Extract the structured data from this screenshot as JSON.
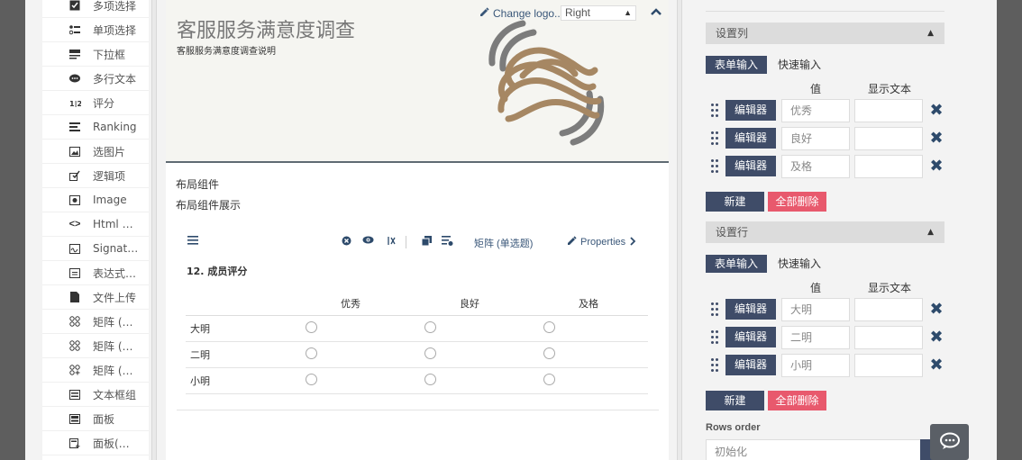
{
  "toolbox": {
    "items": [
      {
        "label": "多项选择",
        "icon": "checkbox-icon"
      },
      {
        "label": "单项选择",
        "icon": "radiogroup-icon"
      },
      {
        "label": "下拉框",
        "icon": "dropdown-icon"
      },
      {
        "label": "多行文本",
        "icon": "comment-icon"
      },
      {
        "label": "评分",
        "icon": "rating-icon"
      },
      {
        "label": "Ranking",
        "icon": "ranking-icon"
      },
      {
        "label": "选图片",
        "icon": "image-picker-icon"
      },
      {
        "label": "逻辑项",
        "icon": "boolean-icon"
      },
      {
        "label": "Image",
        "icon": "image-icon"
      },
      {
        "label": "Html …",
        "icon": "html-icon"
      },
      {
        "label": "Signat…",
        "icon": "signature-icon"
      },
      {
        "label": "表达式…",
        "icon": "expression-icon"
      },
      {
        "label": "文件上传",
        "icon": "file-icon"
      },
      {
        "label": "矩阵 (…",
        "icon": "matrix-icon"
      },
      {
        "label": "矩阵 (…",
        "icon": "matrix-dropdown-icon"
      },
      {
        "label": "矩阵 (…",
        "icon": "matrix-dynamic-icon"
      },
      {
        "label": "文本框组",
        "icon": "multiple-text-icon"
      },
      {
        "label": "面板",
        "icon": "panel-icon"
      },
      {
        "label": "面板(…",
        "icon": "panel-dynamic-icon"
      }
    ]
  },
  "header": {
    "title": "客服服务满意度调查",
    "description": "客服服务满意度调查说明",
    "change_logo": "Change logo...",
    "logo_position": "Right"
  },
  "page": {
    "title": "布局组件",
    "description": "布局组件展示"
  },
  "question": {
    "type_label": "矩阵 (单选题)",
    "properties_label": "Properties",
    "title": "12. 成员评分",
    "columns": [
      "优秀",
      "良好",
      "及格"
    ],
    "rows": [
      "大明",
      "二明",
      "小明"
    ]
  },
  "props": {
    "columns_section": {
      "title": "设置列",
      "tab_form": "表单输入",
      "tab_fast": "快速输入",
      "value_header": "值",
      "text_header": "显示文本",
      "edit_label": "编辑器",
      "items": [
        "优秀",
        "良好",
        "及格"
      ],
      "new_label": "新建",
      "delete_all_label": "全部删除"
    },
    "rows_section": {
      "title": "设置行",
      "tab_form": "表单输入",
      "tab_fast": "快速输入",
      "value_header": "值",
      "text_header": "显示文本",
      "edit_label": "编辑器",
      "items": [
        "大明",
        "二明",
        "小明"
      ],
      "new_label": "新建",
      "delete_all_label": "全部删除"
    },
    "rows_order_label": "Rows order",
    "rows_order_value": "初始化"
  }
}
